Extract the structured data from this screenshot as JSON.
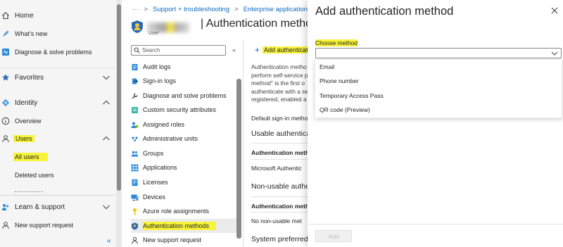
{
  "left_nav": {
    "home": "Home",
    "whats_new": "What's new",
    "diagnose": "Diagnose & solve problems",
    "favorites": "Favorites",
    "identity": "Identity",
    "overview": "Overview",
    "users": "Users",
    "all_users": "All users",
    "deleted_users": "Deleted users",
    "learn_support": "Learn & support",
    "new_support_request": "New support request",
    "collapse": "«"
  },
  "breadcrumb": {
    "ellipsis": "···",
    "items": [
      "Support + troubleshooting",
      "Enterprise applications |"
    ]
  },
  "header": {
    "title": "| Authentication metho",
    "subtitle": "User"
  },
  "menu": {
    "search_placeholder": "Search",
    "collapse": "«",
    "items": [
      "Audit logs",
      "Sign-in logs",
      "Diagnose and solve problems",
      "Custom security attributes",
      "Assigned roles",
      "Administrative units",
      "Groups",
      "Applications",
      "Licenses",
      "Devices",
      "Azure role assignments",
      "Authentication methods",
      "New support request"
    ],
    "active_item": "Authentication methods"
  },
  "content": {
    "add_button": "Add authenticati",
    "description_lines": [
      "Authentication metho",
      "perform self-service p",
      "method\" is the first o",
      "authenticate with a se",
      "registered, enabled a"
    ],
    "default_signin": "Default sign-in metho",
    "usable_heading": "Usable authenticat",
    "table1_header": "Authentication meth",
    "table1_row": "Microsoft Authentic",
    "nonusable_heading": "Non-usable auther",
    "table2_header": "Authentication meth",
    "table2_row": "No non-usable met",
    "system_preferred": "System preferred n"
  },
  "dialog": {
    "title": "Add authentication method",
    "choose_label": "Choose method",
    "selected_value": "",
    "options": [
      "Email",
      "Phone number",
      "Temporary Access Pass",
      "QR code (Preview)"
    ],
    "add_button": "Add",
    "add_enabled": false
  },
  "colors": {
    "highlight": "#f7f33b",
    "link_blue": "#0f6cbd",
    "nav_bg": "#f5f5f5"
  }
}
